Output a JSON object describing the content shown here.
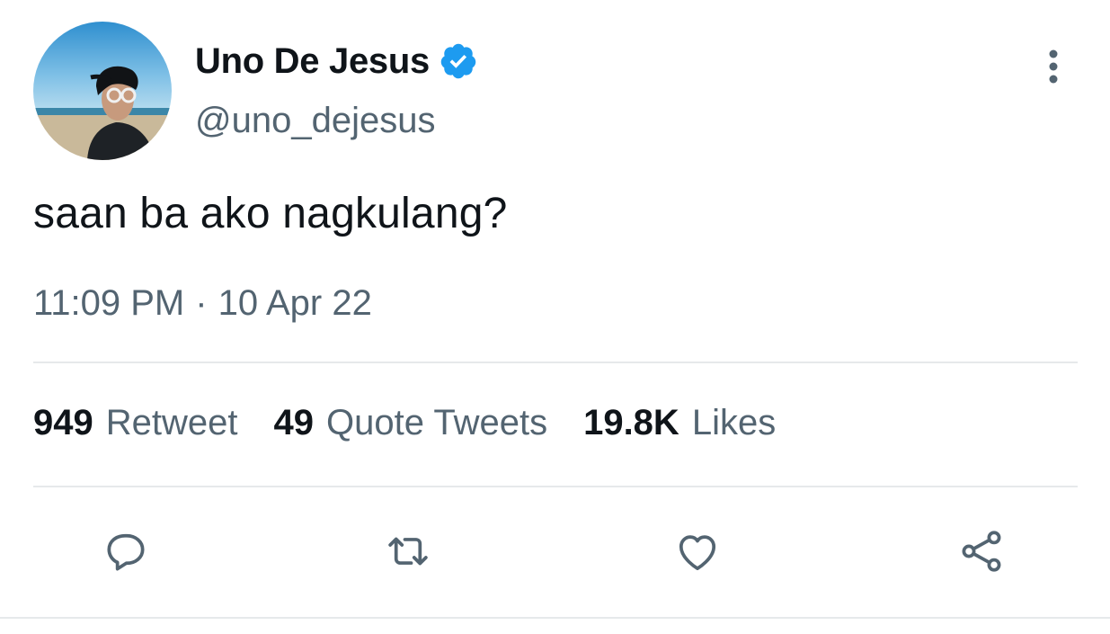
{
  "author": {
    "display_name": "Uno De Jesus",
    "handle": "@uno_dejesus",
    "verified": true,
    "verified_color": "#1d9bf0"
  },
  "tweet": {
    "text": "saan ba ako nagkulang?",
    "time": "11:09 PM",
    "separator": "·",
    "date": "10 Apr 22"
  },
  "stats": {
    "retweets_count": "949",
    "retweets_label": "Retweet",
    "quotes_count": "49",
    "quotes_label": "Quote Tweets",
    "likes_count": "19.8K",
    "likes_label": "Likes"
  },
  "actions": {
    "reply_icon": "reply-icon",
    "retweet_icon": "retweet-icon",
    "like_icon": "heart-icon",
    "share_icon": "share-icon"
  },
  "colors": {
    "text_primary": "#0f1419",
    "text_secondary": "#536471",
    "divider": "#e6e9eb"
  }
}
